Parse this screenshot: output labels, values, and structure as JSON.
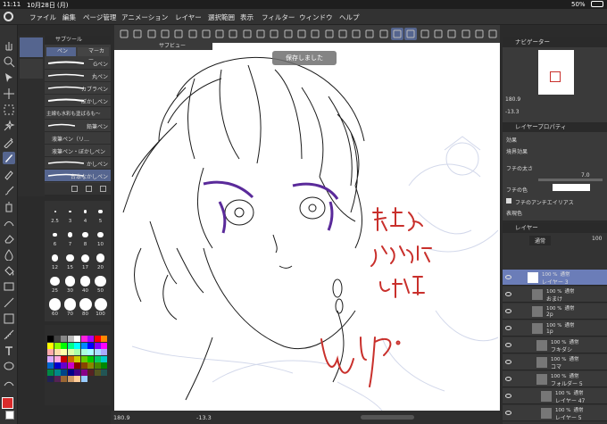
{
  "status": {
    "time": "11:11",
    "date": "10月28日 (月)",
    "battery": "50%"
  },
  "menu": [
    "ファイル",
    "編集",
    "ページ管理",
    "アニメーション",
    "レイヤー",
    "選択範囲",
    "表示",
    "フィルター",
    "ウィンドウ",
    "ヘルプ"
  ],
  "subtool": {
    "title": "サブツール",
    "tabs": [
      "ペン",
      "マーカー"
    ],
    "brushes": [
      "Gペン",
      "丸ペン",
      "カブラペン",
      "ぼかしペン",
      "主線も水彩も塗ばるも〜",
      "鉛筆ペン",
      "液筆ペン（リ…",
      "液筆ペン・ぼかしペン",
      "かしペン",
      "台本なかしペン"
    ]
  },
  "brush_sizes": [
    "2.5",
    "3",
    "4",
    "5",
    "6",
    "7",
    "8",
    "10",
    "12",
    "15",
    "17",
    "20",
    "25",
    "30",
    "40",
    "50",
    "60",
    "70",
    "80",
    "100"
  ],
  "canvas": {
    "tab": "サブビュー",
    "toast": "保存しました"
  },
  "bottom": {
    "zoom": "180.9",
    "angle": "-13.3"
  },
  "navigator": {
    "title": "ナビゲーター",
    "zoom": "180.9",
    "angle": "-13.3"
  },
  "layer_property": {
    "title": "レイヤープロパティ",
    "effect": "効果",
    "border_effect": "境界効果",
    "border_width": "フチの太さ",
    "border_value": "7.0",
    "border_color": "フチの色",
    "antialias": "フチのアンチエイリアス",
    "expression": "表現色"
  },
  "layer_panel": {
    "title": "レイヤー",
    "blend": "通常",
    "opacity": "100",
    "layers": [
      {
        "opacity": "100 %",
        "mode": "通常",
        "name": "レイヤー 3",
        "selected": true
      },
      {
        "opacity": "100 %",
        "mode": "通常",
        "name": "おまけ",
        "selected": false
      },
      {
        "opacity": "100 %",
        "mode": "通常",
        "name": "2p",
        "selected": false
      },
      {
        "opacity": "100 %",
        "mode": "通常",
        "name": "1p",
        "selected": false
      },
      {
        "opacity": "100 %",
        "mode": "通常",
        "name": "フキダシ",
        "selected": false
      },
      {
        "opacity": "100 %",
        "mode": "通常",
        "name": "コマ",
        "selected": false
      },
      {
        "opacity": "100 %",
        "mode": "通常",
        "name": "フォルダー 5",
        "selected": false
      },
      {
        "opacity": "100 %",
        "mode": "通常",
        "name": "レイヤー 47",
        "selected": false
      },
      {
        "opacity": "100 %",
        "mode": "通常",
        "name": "レイヤー 5",
        "selected": false
      }
    ]
  },
  "annotation": {
    "line1": "髪のも",
    "line2": "ふわふわ度",
    "line3": "5割増",
    "wip": "wip."
  },
  "colors": {
    "accent": "#6b7db8",
    "drawing_red": "#c9302c",
    "eye_purple": "#5a2a9a",
    "selected_color": "#d92b2b"
  }
}
